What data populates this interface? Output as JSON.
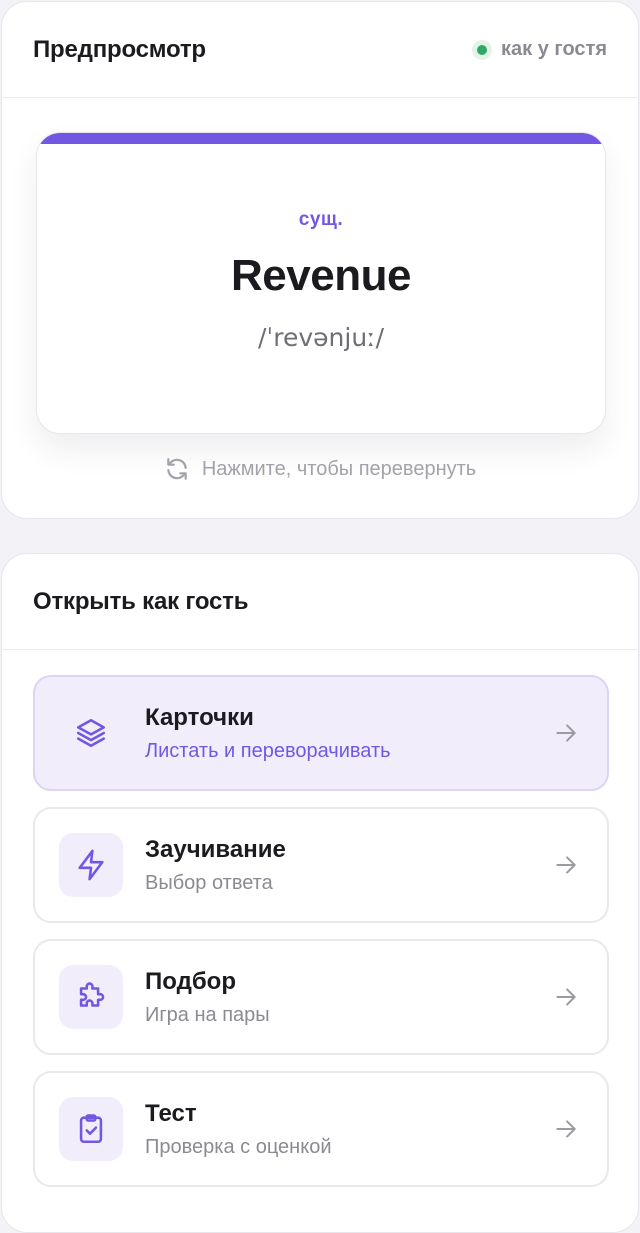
{
  "preview": {
    "title": "Предпросмотр",
    "guest_badge": "как у гостя",
    "card": {
      "part_of_speech": "сущ.",
      "word": "Revenue",
      "transcription": "/ˈrevənjuː/"
    },
    "flip_hint": "Нажмите, чтобы перевернуть"
  },
  "guest": {
    "title": "Открыть как гость",
    "modes": [
      {
        "name": "Карточки",
        "description": "Листать и переворачивать",
        "icon": "layers-icon",
        "active": true
      },
      {
        "name": "Заучивание",
        "description": "Выбор ответа",
        "icon": "lightning-icon",
        "active": false
      },
      {
        "name": "Подбор",
        "description": "Игра на пары",
        "icon": "puzzle-icon",
        "active": false
      },
      {
        "name": "Тест",
        "description": "Проверка с оценкой",
        "icon": "clipboard-check-icon",
        "active": false
      }
    ]
  },
  "colors": {
    "accent": "#7357e2",
    "accent_soft": "#f1edfb",
    "online": "#2fa866",
    "muted_text": "#8a8a93"
  }
}
